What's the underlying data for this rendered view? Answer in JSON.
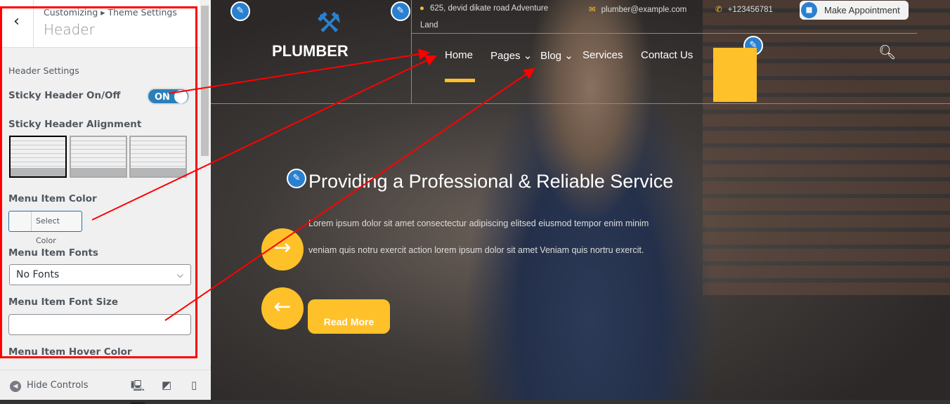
{
  "customizer": {
    "breadcrumb": "Customizing ▸ Theme Settings",
    "title": "Header",
    "section": "Header Settings",
    "sticky_label": "Sticky Header On/Off",
    "sticky_value": "ON",
    "alignment_label": "Sticky Header Alignment",
    "menu_color_label": "Menu Item Color",
    "select_color": "Select Color",
    "menu_fonts_label": "Menu Item Fonts",
    "menu_fonts_value": "No Fonts",
    "font_size_label": "Menu Item Font Size",
    "font_size_value": "",
    "hover_color_label": "Menu Item Hover Color",
    "hide_controls": "Hide Controls",
    "devices": [
      "desktop-icon",
      "tablet-icon",
      "mobile-icon"
    ]
  },
  "site": {
    "logo": "PLUMBER",
    "address": "625, devid dikate road Adventure",
    "address2": "Land",
    "email": "plumber@example.com",
    "phone": "+123456781",
    "appointment": "Make Appointment",
    "nav": [
      "Home",
      "Pages",
      "Blog",
      "Services",
      "Contact Us"
    ],
    "headline": "Providing a Professional & Reliable Service",
    "text1": "Lorem ipsum dolor sit amet consectectur adipiscing elitsed eiusmod tempor enim minim",
    "text2": "veniam quis notru exercit action lorem ipsum dolor sit amet Veniam quis nortru exercit.",
    "read_more": "Read More"
  },
  "colors": {
    "accent": "#ffc12a",
    "toggle": "#2a80b9",
    "annotation": "#ff0000"
  }
}
